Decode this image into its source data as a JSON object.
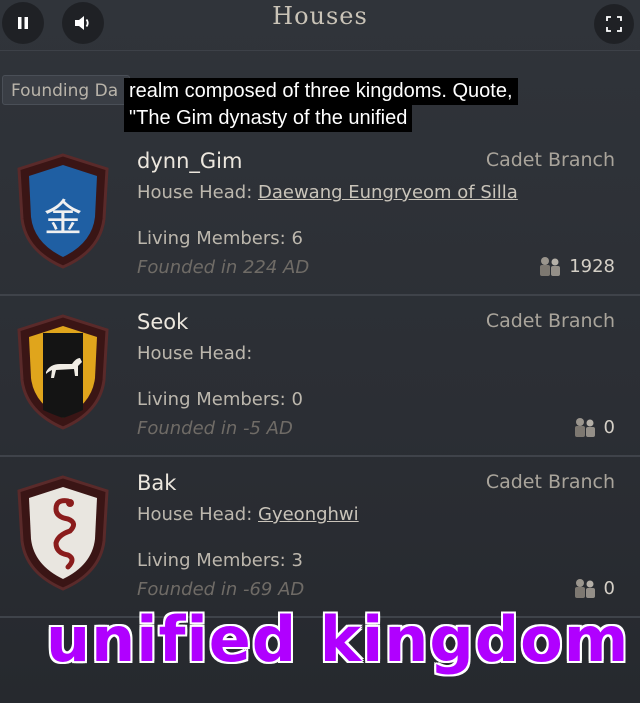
{
  "header": {
    "title": "Houses"
  },
  "toolbar": {
    "sort_label": "Founding Da"
  },
  "caption": {
    "line1": "realm composed of three kingdoms. Quote,",
    "line2": "\"The Gim dynasty of the unified"
  },
  "houses": [
    {
      "name": "dynn_Gim",
      "branch": "Cadet Branch",
      "head_label": "House Head:",
      "head_name": "Daewang Eungryeom of Silla",
      "living": "Living Members: 6",
      "founded": "Founded in 224 AD",
      "count": "1928",
      "crest_glyph": "金",
      "crest_color": "#1f5fa3"
    },
    {
      "name": "Seok",
      "branch": "Cadet Branch",
      "head_label": "House Head:",
      "head_name": "",
      "living": "Living Members: 0",
      "founded": "Founded in -5 AD",
      "count": "0",
      "crest_color": "#e0a51c"
    },
    {
      "name": "Bak",
      "branch": "Cadet Branch",
      "head_label": "House Head:",
      "head_name": "Gyeonghwi",
      "living": "Living Members: 3",
      "founded": "Founded in -69 AD",
      "count": "0",
      "crest_color": "#e9e6e0"
    }
  ],
  "overlay": {
    "text": "unified kingdom"
  }
}
